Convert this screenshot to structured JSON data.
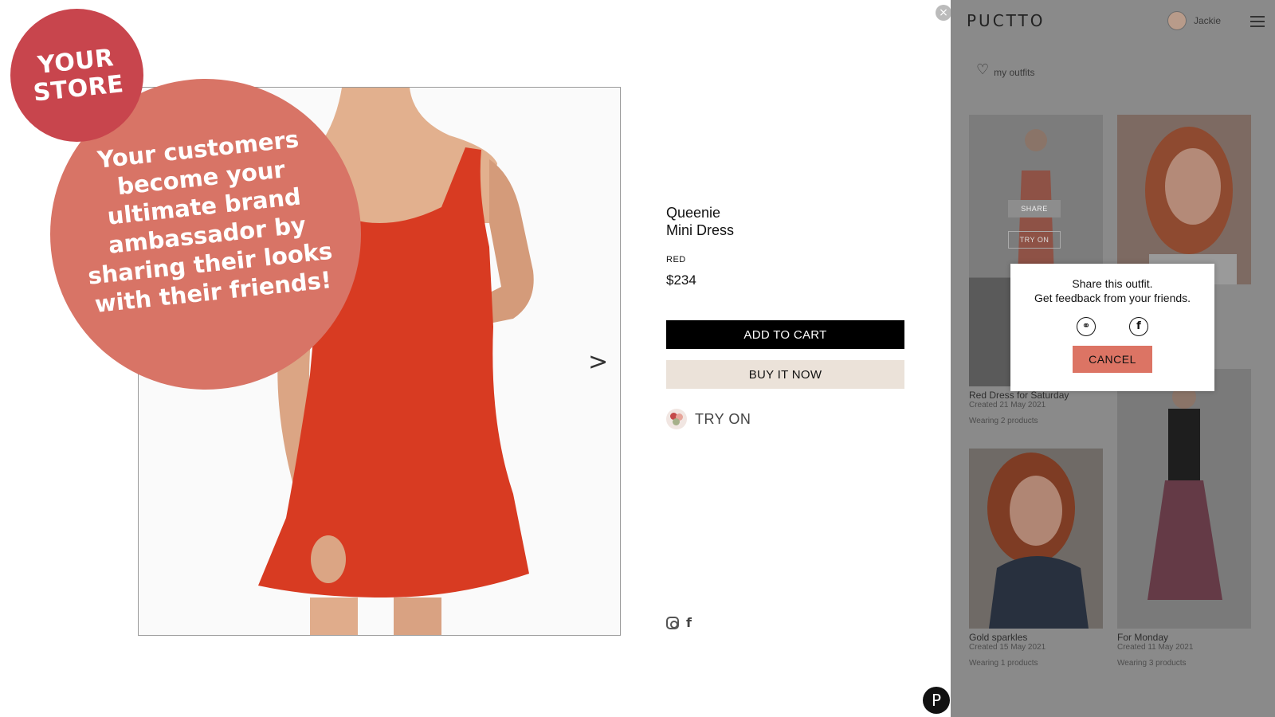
{
  "promo": {
    "small_circle": "YOUR\nSTORE",
    "big_circle": "Your customers become your ultimate brand ambassador by sharing their looks with their friends!"
  },
  "product": {
    "name_line1": "Queenie",
    "name_line2": "Mini Dress",
    "color": "RED",
    "price": "$234",
    "add_to_cart": "ADD TO CART",
    "buy_now": "BUY IT NOW",
    "try_on": "TRY ON",
    "next_arrow": ">"
  },
  "icons": {
    "close": "×",
    "puctto_logo": "P",
    "instagram": "instagram-icon",
    "facebook": "f"
  },
  "panel": {
    "brand": "PUCTTO",
    "user_name": "Jackie",
    "my_outfits": "my outfits",
    "heart": "♡",
    "outfits": [
      {
        "title": "Red Dress for Saturday",
        "created": "Created 21 May 2021",
        "wearing": "Wearing 2 products",
        "share": "SHARE",
        "try_on": "TRY ON"
      },
      {
        "title": "",
        "created": "",
        "wearing": ""
      },
      {
        "title": "Gold sparkles",
        "created": "Created 15 May 2021",
        "wearing": "Wearing 1 products"
      },
      {
        "title": "For Monday",
        "created": "Created 11 May 2021",
        "wearing": "Wearing 3 products"
      }
    ]
  },
  "dialog": {
    "line1": "Share this outfit.",
    "line2": "Get feedback from your friends.",
    "link_icon": "⚭",
    "facebook_icon": "f",
    "cancel": "CANCEL"
  },
  "colors": {
    "promo_small": "#c8454d",
    "promo_big": "#d87466",
    "dress_red": "#d83b22",
    "cancel_button": "#dc7464",
    "buy_now_bg": "#ebe2d9",
    "panel_overlay": "#8a8a8a"
  }
}
